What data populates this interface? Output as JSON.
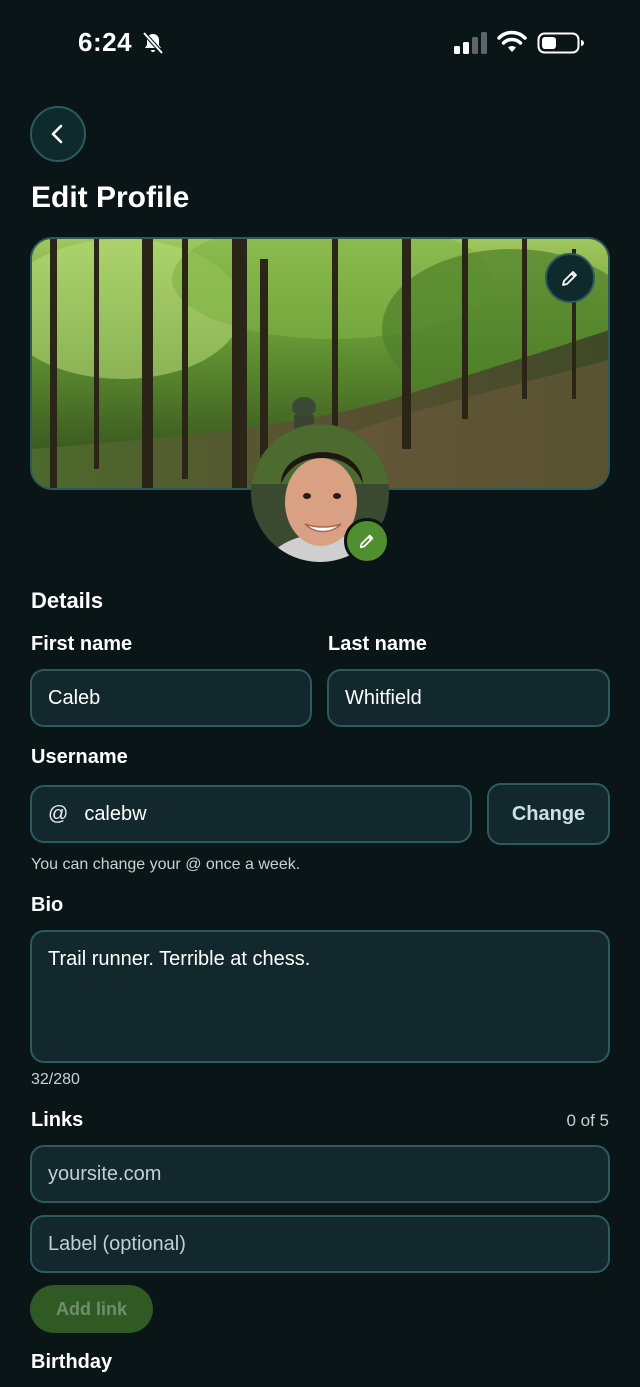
{
  "status_bar": {
    "time": "6:24",
    "icons": [
      "bell-slash-icon",
      "cellular-signal-icon",
      "wifi-icon",
      "battery-icon"
    ]
  },
  "header": {
    "back_icon": "chevron-left-icon",
    "title": "Edit Profile"
  },
  "profile_media": {
    "banner_edit_icon": "pencil-icon",
    "avatar_edit_icon": "pencil-icon"
  },
  "details": {
    "section_title": "Details",
    "first_name_label": "First name",
    "first_name_value": "Caleb",
    "last_name_label": "Last name",
    "last_name_value": "Whitfield",
    "username_label": "Username",
    "username_prefix": "@",
    "username_value": "calebw",
    "change_button": "Change",
    "username_hint": "You can change your @ once a week.",
    "bio_label": "Bio",
    "bio_value": "Trail runner. Terrible at chess.",
    "bio_counter": "32/280"
  },
  "links": {
    "label": "Links",
    "count": "0 of 5",
    "url_placeholder": "yoursite.com",
    "label_placeholder": "Label (optional)",
    "add_button": "Add link"
  },
  "birthday": {
    "label": "Birthday"
  },
  "colors": {
    "background": "#0a1517",
    "field_background": "#12282d",
    "field_border": "#2d5a5d",
    "accent_green": "#4f8f2f"
  }
}
